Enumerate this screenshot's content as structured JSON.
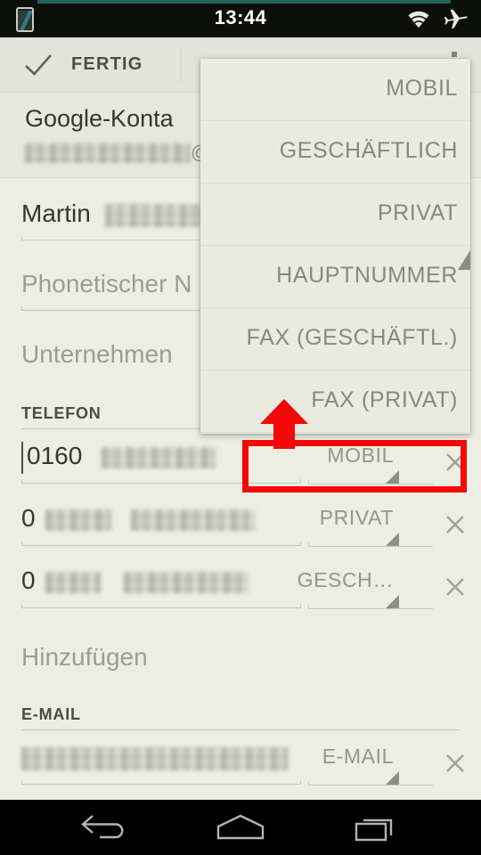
{
  "status_bar": {
    "clock": "13:44",
    "device_icon": "device-phone-icon",
    "wifi_icon": "wifi-icon",
    "airplane_icon": "airplane-mode-icon",
    "accent_color": "#23645f"
  },
  "action_bar": {
    "done_label": "FERTIG",
    "check_icon": "checkmark-icon",
    "overflow_icon": "overflow-menu-icon"
  },
  "account": {
    "type": "Google-Konta",
    "email_redacted": "",
    "email_suffix": "@g"
  },
  "fields": {
    "name_value": "Martin",
    "name_redacted": "",
    "phonetic_placeholder": "Phonetischer N",
    "company_placeholder": "Unternehmen"
  },
  "phone_section": {
    "header": "TELEFON",
    "rows": [
      {
        "value": "0160",
        "redacted": true,
        "type": "MOBIL",
        "focused": true
      },
      {
        "value": "0",
        "redacted": true,
        "type": "PRIVAT",
        "focused": false
      },
      {
        "value": "0",
        "redacted": true,
        "type": "GESCH…",
        "focused": false
      }
    ],
    "add_label": "Hinzufügen"
  },
  "email_section": {
    "header": "E-MAIL",
    "rows": [
      {
        "value": "",
        "redacted": true,
        "type": "E-MAIL"
      }
    ]
  },
  "dropdown": {
    "items": [
      {
        "label": "MOBIL"
      },
      {
        "label": "GESCHÄFTLICH"
      },
      {
        "label": "PRIVAT"
      },
      {
        "label": "HAUPTNUMMER"
      },
      {
        "label": "FAX (GESCHÄFTL.)"
      },
      {
        "label": "FAX (PRIVAT)"
      }
    ]
  },
  "annotations": {
    "highlight_color": "#f50808",
    "arrow_color": "#f50808"
  },
  "nav_bar": {
    "back_icon": "back-arrow-icon",
    "home_icon": "home-icon",
    "recents_icon": "recent-apps-icon"
  }
}
